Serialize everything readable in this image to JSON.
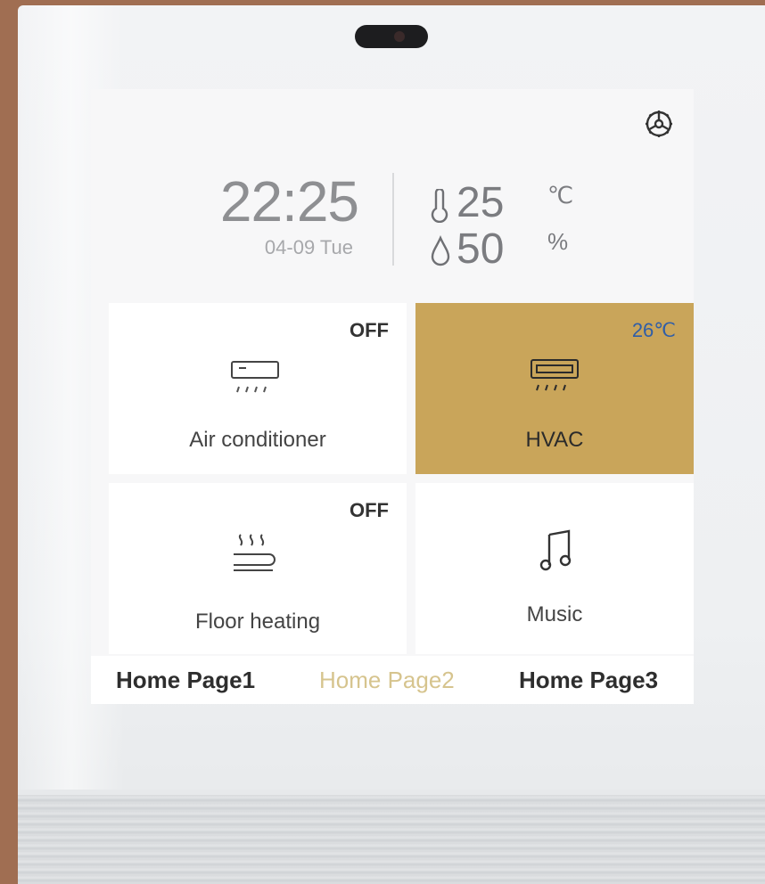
{
  "clock": {
    "time": "22:25",
    "date": "04-09 Tue"
  },
  "climate": {
    "temperature": "25",
    "temperature_unit": "℃",
    "humidity": "50",
    "humidity_unit": "%"
  },
  "tiles": [
    {
      "label": "Air conditioner",
      "state": "OFF",
      "icon": "air-conditioner-icon"
    },
    {
      "label": "HVAC",
      "state": "26℃",
      "icon": "hvac-icon",
      "active": true
    },
    {
      "label": "Floor heating",
      "state": "OFF",
      "icon": "floor-heating-icon"
    },
    {
      "label": "Music",
      "state": "",
      "icon": "music-note-icon"
    }
  ],
  "tabs": [
    {
      "label": "Home Page1"
    },
    {
      "label": "Home Page2",
      "active": true
    },
    {
      "label": "Home Page3"
    }
  ],
  "colors": {
    "accent": "#c9a55a",
    "active_tab": "#d6c48e",
    "hvac_temp": "#2f5ea8",
    "frame": "#a06e52"
  }
}
